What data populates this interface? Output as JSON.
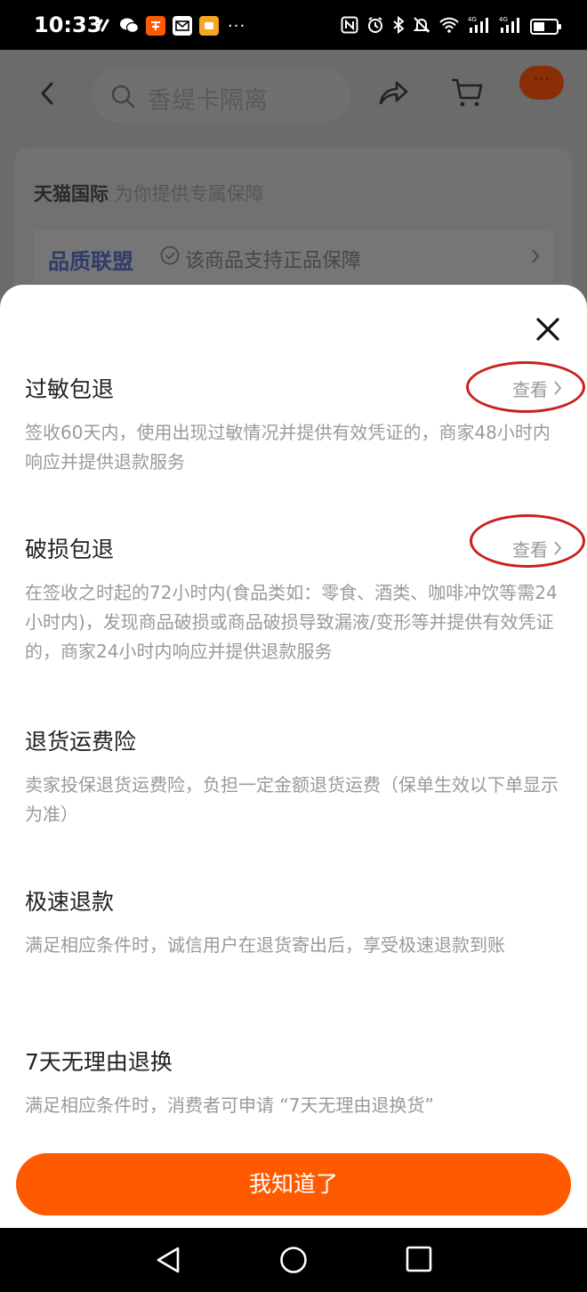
{
  "status_bar": {
    "time": "10:33",
    "left_icons": [
      "lightning-icon",
      "wechat-icon",
      "taobao-icon",
      "mail-icon",
      "app-icon"
    ],
    "more": "···",
    "right_icons": [
      "nfc-icon",
      "alarm-icon",
      "bluetooth-icon",
      "mute-icon",
      "wifi-icon",
      "signal-4g-icon",
      "signal-4g-icon",
      "battery-icon"
    ],
    "battery_level": 0.5
  },
  "background_page": {
    "search_placeholder": "香缇卡隔离",
    "more_label": "···",
    "card_brand": "天猫国际",
    "card_subtitle": "为你提供专属保障",
    "quality_union": "品质联盟",
    "guarantee_text": "该商品支持正品保障"
  },
  "sheet": {
    "sections": [
      {
        "title": "过敏包退",
        "desc": "签收60天内，使用出现过敏情况并提供有效凭证的，商家48小时内响应并提供退款服务",
        "link": "查看"
      },
      {
        "title": "破损包退",
        "desc": "在签收之时起的72小时内(食品类如：零食、酒类、咖啡冲饮等需24小时内)，发现商品破损或商品破损导致漏液/变形等并提供有效凭证的，商家24小时内响应并提供退款服务",
        "link": "查看"
      },
      {
        "title": "退货运费险",
        "desc": "卖家投保退货运费险，负担一定金额退货运费（保单生效以下单显示为准）"
      },
      {
        "title": "极速退款",
        "desc": "满足相应条件时，诚信用户在退货寄出后，享受极速退款到账"
      },
      {
        "title": "7天无理由退换",
        "desc": "满足相应条件时，消费者可申请 “7天无理由退换货”"
      }
    ],
    "ok_button": "我知道了"
  },
  "colors": {
    "accent": "#ff5a00",
    "annotation_ring": "#c8201e",
    "desc_text": "#9a9a9a",
    "title_text": "#222222"
  }
}
